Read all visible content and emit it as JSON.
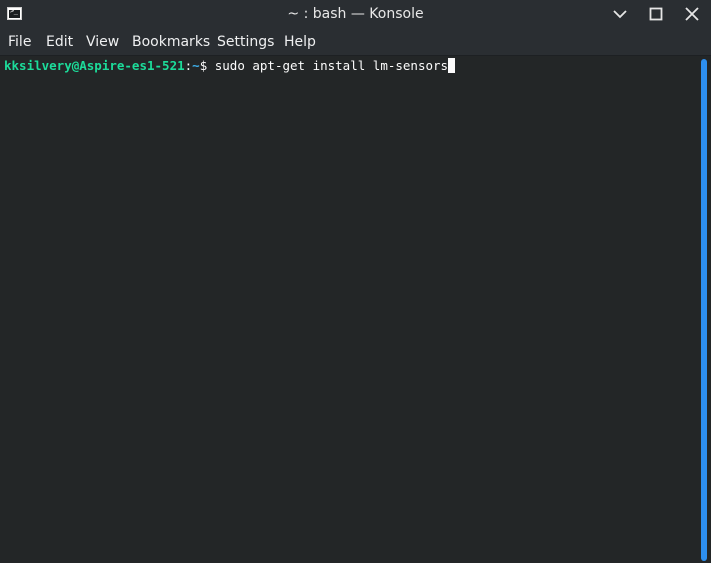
{
  "window": {
    "title": "~ : bash — Konsole"
  },
  "menubar": {
    "items": [
      "File",
      "Edit",
      "View",
      "Bookmarks",
      "Settings",
      "Help"
    ]
  },
  "terminal": {
    "user_host": "kksilvery@Aspire-es1-521",
    "separator": ":",
    "path": "~",
    "prompt_symbol": "$ ",
    "command": "sudo apt-get install lm-sensors"
  },
  "colors": {
    "background": "#232627",
    "chrome": "#2a2e32",
    "prompt_user": "#1cdc9a",
    "scroll_thumb": "#2d8ff0"
  },
  "icons": {
    "app": "konsole-terminal-icon",
    "minimize": "minimize-icon",
    "maximize": "maximize-icon",
    "close": "close-icon"
  }
}
